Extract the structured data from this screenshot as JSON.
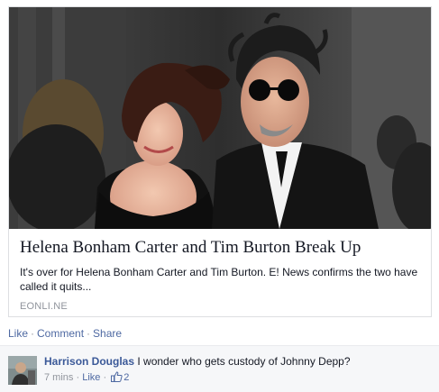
{
  "link_preview": {
    "title": "Helena Bonham Carter and Tim Burton Break Up",
    "description": "It's over for Helena Bonham Carter and Tim Burton.  E! News confirms the two have called it quits...",
    "domain": "EONLI.NE",
    "image_icon": "photo-couple-red-carpet"
  },
  "post_actions": {
    "like": "Like",
    "comment": "Comment",
    "share": "Share",
    "separator": "·"
  },
  "comment": {
    "author": "Harrison Douglas",
    "text": "I wonder who gets custody of Johnny Depp?",
    "time": "7 mins",
    "separator": "·",
    "like_label": "Like",
    "like_count": "2",
    "like_icon": "thumbs-up-icon",
    "avatar_icon": "user-avatar"
  },
  "colors": {
    "link": "#4e69a2",
    "author": "#3b5998",
    "meta": "#90949c",
    "comment_bg": "#f6f7f9"
  }
}
